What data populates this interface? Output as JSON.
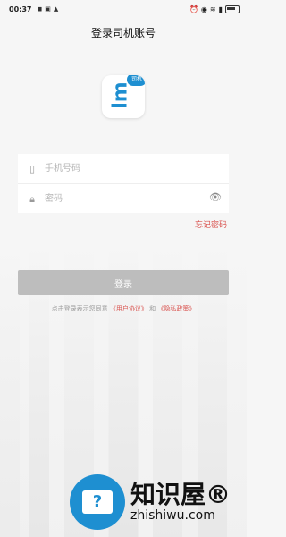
{
  "status": {
    "time": "00:37",
    "left_icons": [
      "notification-icon",
      "photo-icon",
      "alert-icon"
    ],
    "right_icons": [
      "alarm-icon",
      "location-icon",
      "wifi-icon",
      "signal-icon",
      "battery-icon"
    ]
  },
  "header": {
    "title": "登录司机账号"
  },
  "logo": {
    "badge": "司机",
    "letters": "lm",
    "brand_color": "#1e8fd1"
  },
  "form": {
    "phone_placeholder": "手机号码",
    "password_placeholder": "密码"
  },
  "forgot_password": "忘记密码",
  "login_button": "登录",
  "agreement": {
    "prefix": "点击登录表示您同意",
    "user_agreement": "《用户协议》",
    "and": "和",
    "privacy_policy": "《隐私政策》"
  },
  "watermark": {
    "cn": "知识屋",
    "reg": "®",
    "en": "zhishiwu.com"
  },
  "colors": {
    "accent": "#d9534f",
    "button_disabled": "#bdbdbd"
  }
}
